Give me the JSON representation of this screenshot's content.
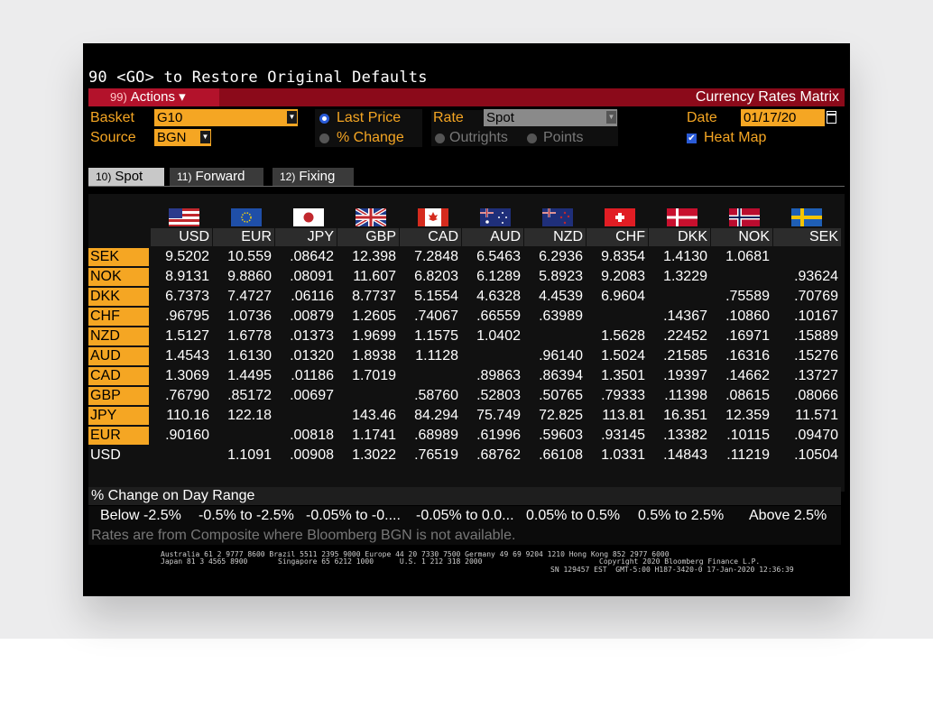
{
  "command_line": "90 <GO> to Restore Original Defaults",
  "menu": {
    "actions_number": "99)",
    "actions_label": "Actions ▾",
    "title": "Currency Rates Matrix"
  },
  "basket": {
    "label": "Basket",
    "value": "G10"
  },
  "source": {
    "label": "Source",
    "value": "BGN"
  },
  "display": {
    "last_price": "Last Price",
    "pct_change": "% Change",
    "selected": "last_price"
  },
  "rate": {
    "label": "Rate",
    "value": "Spot",
    "outrights": "Outrights",
    "points": "Points"
  },
  "date": {
    "label": "Date",
    "value": "01/17/20"
  },
  "heat_map": {
    "label": "Heat Map",
    "checked": true
  },
  "tabs": [
    {
      "number": "10)",
      "label": "Spot",
      "active": true
    },
    {
      "number": "11)",
      "label": "Forward",
      "active": false
    },
    {
      "number": "12)",
      "label": "Fixing",
      "active": false
    }
  ],
  "columns": [
    "USD",
    "EUR",
    "JPY",
    "GBP",
    "CAD",
    "AUD",
    "NZD",
    "CHF",
    "DKK",
    "NOK",
    "SEK"
  ],
  "flag_icons": [
    "us-flag-icon",
    "eu-flag-icon",
    "japan-flag-icon",
    "uk-flag-icon",
    "canada-flag-icon",
    "australia-flag-icon",
    "new-zealand-flag-icon",
    "switzerland-flag-icon",
    "denmark-flag-icon",
    "norway-flag-icon",
    "sweden-flag-icon"
  ],
  "rows": [
    {
      "ccy": "SEK",
      "values": [
        "9.5202",
        "10.559",
        ".08642",
        "12.398",
        "7.2848",
        "6.5463",
        "6.2936",
        "9.8354",
        "1.4130",
        "1.0681",
        ""
      ]
    },
    {
      "ccy": "NOK",
      "values": [
        "8.9131",
        "9.8860",
        ".08091",
        "11.607",
        "6.8203",
        "6.1289",
        "5.8923",
        "9.2083",
        "1.3229",
        "",
        ".93624"
      ]
    },
    {
      "ccy": "DKK",
      "values": [
        "6.7373",
        "7.4727",
        ".06116",
        "8.7737",
        "5.1554",
        "4.6328",
        "4.4539",
        "6.9604",
        "",
        ".75589",
        ".70769"
      ]
    },
    {
      "ccy": "CHF",
      "values": [
        ".96795",
        "1.0736",
        ".00879",
        "1.2605",
        ".74067",
        ".66559",
        ".63989",
        "",
        ".14367",
        ".10860",
        ".10167"
      ]
    },
    {
      "ccy": "NZD",
      "values": [
        "1.5127",
        "1.6778",
        ".01373",
        "1.9699",
        "1.1575",
        "1.0402",
        "",
        "1.5628",
        ".22452",
        ".16971",
        ".15889"
      ]
    },
    {
      "ccy": "AUD",
      "values": [
        "1.4543",
        "1.6130",
        ".01320",
        "1.8938",
        "1.1128",
        "",
        ".96140",
        "1.5024",
        ".21585",
        ".16316",
        ".15276"
      ]
    },
    {
      "ccy": "CAD",
      "values": [
        "1.3069",
        "1.4495",
        ".01186",
        "1.7019",
        "",
        ".89863",
        ".86394",
        "1.3501",
        ".19397",
        ".14662",
        ".13727"
      ]
    },
    {
      "ccy": "GBP",
      "values": [
        ".76790",
        ".85172",
        ".00697",
        "",
        ".58760",
        ".52803",
        ".50765",
        ".79333",
        ".11398",
        ".08615",
        ".08066"
      ]
    },
    {
      "ccy": "JPY",
      "values": [
        "110.16",
        "122.18",
        "",
        "143.46",
        "84.294",
        "75.749",
        "72.825",
        "113.81",
        "16.351",
        "12.359",
        "11.571"
      ]
    },
    {
      "ccy": "EUR",
      "values": [
        ".90160",
        "",
        ".00818",
        "1.1741",
        ".68989",
        ".61996",
        ".59603",
        ".93145",
        ".13382",
        ".10115",
        ".09470"
      ]
    },
    {
      "ccy": "USD",
      "values": [
        "",
        "1.1091",
        ".00908",
        "1.3022",
        ".76519",
        ".68762",
        ".66108",
        "1.0331",
        ".14843",
        ".11219",
        ".10504"
      ]
    }
  ],
  "pct_change_title": "% Change on Day Range",
  "legend": [
    "Below -2.5%",
    "-0.5% to -2.5%",
    "-0.05% to -0....",
    "-0.05% to 0.0...",
    "0.05% to 0.5%",
    "0.5% to 2.5%",
    "Above 2.5%"
  ],
  "note": "Rates are from Composite where Bloomberg BGN is not available.",
  "footer": {
    "line1": "Australia 61 2 9777 8600 Brazil 5511 2395 9000 Europe 44 20 7330 7500 Germany 49 69 9204 1210 Hong Kong 852 2977 6000",
    "line2a": "Japan 81 3 4565 8900       Singapore 65 6212 1000      U.S. 1 212 318 2000",
    "line2b": "Copyright 2020 Bloomberg Finance L.P.",
    "line3": "SN 129457 EST  GMT-5:00 H187-3420-0 17-Jan-2020 12:36:39"
  },
  "colors": {
    "accent_orange": "#f5a623",
    "menu_red": "#8b0a1a",
    "radio_blue": "#2a5bd7"
  }
}
